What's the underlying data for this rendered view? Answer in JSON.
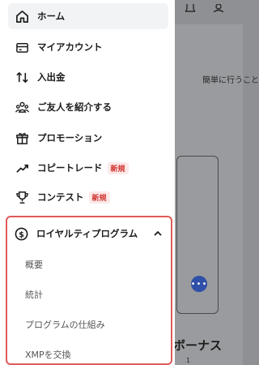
{
  "menu": {
    "items": [
      {
        "label": "ホーム",
        "icon": "home-icon"
      },
      {
        "label": "マイアカウント",
        "icon": "wallet-card-icon"
      },
      {
        "label": "入出金",
        "icon": "transfer-arrows-icon"
      },
      {
        "label": "ご友人を紹介する",
        "icon": "people-group-icon"
      },
      {
        "label": "プロモーション",
        "icon": "gift-icon"
      },
      {
        "label": "コピートレード",
        "icon": "trend-up-icon",
        "badge": "新規"
      },
      {
        "label": "コンテスト",
        "icon": "trophy-icon",
        "badge": "新規"
      }
    ],
    "loyalty": {
      "label": "ロイヤルティプログラム",
      "icon": "dollar-coin-icon",
      "subitems": [
        "概要",
        "統計",
        "プログラムの仕組み",
        "XMPを交換"
      ]
    }
  },
  "background": {
    "subtitle": "簡単に行うこと",
    "bonus_title": "ボーナス",
    "more_button": "•••",
    "bonus_sub": "1"
  },
  "colors": {
    "highlight_border": "#e05a5a",
    "badge_text": "#d0312d",
    "active_bg": "#f2f3f5"
  }
}
